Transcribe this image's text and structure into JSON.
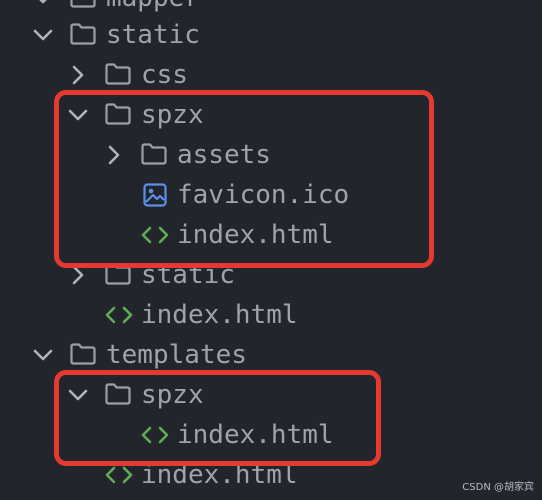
{
  "colors": {
    "background": "#23252c",
    "text": "#9ea3ad",
    "folder": "#9aa0aa",
    "html_icon": "#5fae55",
    "image_icon": "#5b8fe8",
    "highlight": "#e53a2f"
  },
  "tree": {
    "rows": [
      {
        "label": "mapper",
        "icon": "folder-icon",
        "chevron": "chevron-down-icon"
      },
      {
        "label": "static",
        "icon": "folder-icon",
        "chevron": "chevron-down-icon"
      },
      {
        "label": "css",
        "icon": "folder-icon",
        "chevron": "chevron-right-icon"
      },
      {
        "label": "spzx",
        "icon": "folder-icon",
        "chevron": "chevron-down-icon"
      },
      {
        "label": "assets",
        "icon": "folder-icon",
        "chevron": "chevron-right-icon"
      },
      {
        "label": "favicon.ico",
        "icon": "image-file-icon"
      },
      {
        "label": "index.html",
        "icon": "html-file-icon"
      },
      {
        "label": "static",
        "icon": "folder-icon",
        "chevron": "chevron-right-icon"
      },
      {
        "label": "index.html",
        "icon": "html-file-icon"
      },
      {
        "label": "templates",
        "icon": "folder-icon",
        "chevron": "chevron-down-icon"
      },
      {
        "label": "spzx",
        "icon": "folder-icon",
        "chevron": "chevron-down-icon"
      },
      {
        "label": "index.html",
        "icon": "html-file-icon"
      },
      {
        "label": "index.html",
        "icon": "html-file-icon"
      }
    ]
  },
  "watermark": "CSDN @胡家宾"
}
